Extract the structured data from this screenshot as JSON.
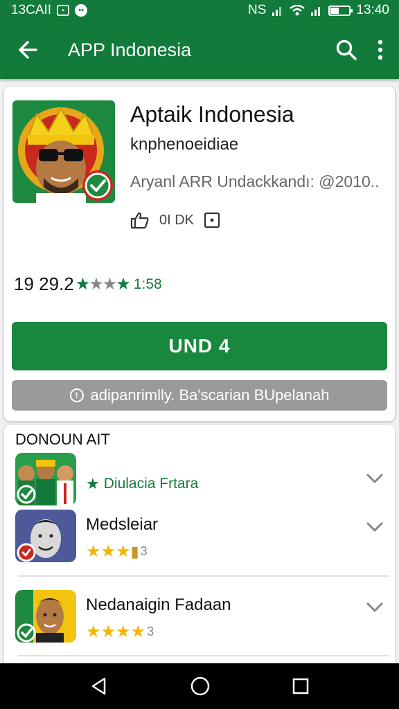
{
  "status_bar": {
    "left_text": "13CAII",
    "network_text": "NS",
    "time": "13:40",
    "icons": [
      "image-icon",
      "face-icon",
      "signal-icon",
      "wifi-icon",
      "signal-icon",
      "battery-icon"
    ]
  },
  "app_bar": {
    "title": "APP Indonesia",
    "icons": [
      "back-arrow-icon",
      "search-icon",
      "more-vert-icon"
    ]
  },
  "app": {
    "name": "Aptaik Indonesia",
    "developer": "knphenoeidiae",
    "meta": "Aryanl ARR Undackkandı: @2010..",
    "stats": "0I DK",
    "rating_value": "19 29.2",
    "rating_text": "1:58",
    "install_label": "UND 4",
    "notice_label": "adipanrimlly. Ba'scarian BUpelanah"
  },
  "list": {
    "header": "DONOUN AIT",
    "items": [
      {
        "title": "",
        "subtitle": "Diulacia Frtara",
        "stars": "",
        "count": "",
        "badge": "check"
      },
      {
        "title": "Medsleiar",
        "subtitle": "",
        "stars": "★★★",
        "count": "3",
        "badge": "red"
      },
      {
        "title": "Nedanaigin Fadaan",
        "subtitle": "",
        "stars": "★★★★",
        "count": "3",
        "badge": "check"
      }
    ]
  },
  "nav_bar": {
    "icons": [
      "back-triangle-icon",
      "home-circle-icon",
      "recents-square-icon"
    ]
  },
  "colors": {
    "primary": "#127a3a",
    "button": "#18883f",
    "notice": "#9a9a9a",
    "star": "#f5b400"
  }
}
